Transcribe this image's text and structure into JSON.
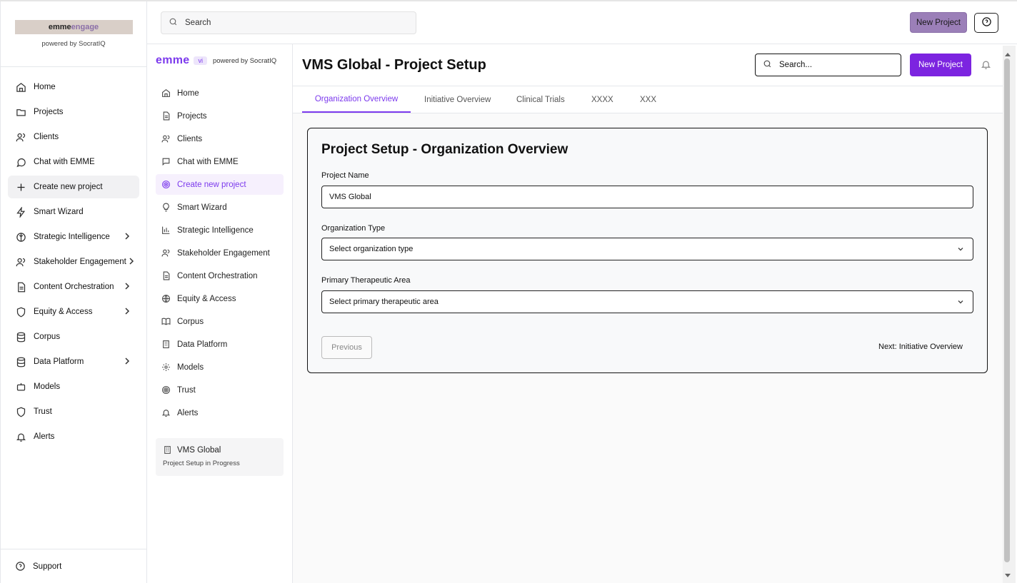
{
  "outer_sidebar": {
    "logo_text_a": "emme",
    "logo_text_b": "engage",
    "powered_by": "powered by SocratIQ",
    "items": [
      {
        "label": "Home",
        "icon": "home-icon"
      },
      {
        "label": "Projects",
        "icon": "folder-icon"
      },
      {
        "label": "Clients",
        "icon": "users-icon"
      },
      {
        "label": "Chat with EMME",
        "icon": "chat-icon"
      },
      {
        "label": "Create new project",
        "icon": "plus-icon",
        "active": true
      },
      {
        "label": "Smart Wizard",
        "icon": "bolt-icon"
      },
      {
        "label": "Strategic Intelligence",
        "icon": "brain-icon",
        "expandable": true
      },
      {
        "label": "Stakeholder Engagement",
        "icon": "users-icon",
        "expandable": true
      },
      {
        "label": "Content Orchestration",
        "icon": "document-icon",
        "expandable": true
      },
      {
        "label": "Equity & Access",
        "icon": "shield-icon",
        "expandable": true
      },
      {
        "label": "Corpus",
        "icon": "database-icon"
      },
      {
        "label": "Data Platform",
        "icon": "database-icon",
        "expandable": true
      },
      {
        "label": "Models",
        "icon": "robot-icon"
      },
      {
        "label": "Trust",
        "icon": "shield-icon"
      },
      {
        "label": "Alerts",
        "icon": "bell-icon"
      }
    ],
    "support_label": "Support"
  },
  "topbar": {
    "search_placeholder": "Search",
    "new_project_label": "New Project"
  },
  "inner_sidebar": {
    "brand": "emme",
    "badge": "vi",
    "powered_by": "powered by SocratIQ",
    "items": [
      {
        "label": "Home",
        "icon": "home-icon"
      },
      {
        "label": "Projects",
        "icon": "document-icon"
      },
      {
        "label": "Clients",
        "icon": "users-icon"
      },
      {
        "label": "Chat with EMME",
        "icon": "chat-icon"
      },
      {
        "label": "Create new project",
        "icon": "target-icon",
        "active": true
      },
      {
        "label": "Smart Wizard",
        "icon": "lightbulb-icon"
      },
      {
        "label": "Strategic Intelligence",
        "icon": "bar-chart-icon"
      },
      {
        "label": "Stakeholder Engagement",
        "icon": "users-icon"
      },
      {
        "label": "Content Orchestration",
        "icon": "document-icon"
      },
      {
        "label": "Equity & Access",
        "icon": "globe-icon"
      },
      {
        "label": "Corpus",
        "icon": "book-icon"
      },
      {
        "label": "Data Platform",
        "icon": "building-icon"
      },
      {
        "label": "Models",
        "icon": "gear-icon"
      },
      {
        "label": "Trust",
        "icon": "target-icon"
      },
      {
        "label": "Alerts",
        "icon": "bell-icon"
      }
    ],
    "project_card": {
      "title": "VMS Global",
      "status": "Project Setup in Progress"
    }
  },
  "main": {
    "title": "VMS Global - Project Setup",
    "search_placeholder": "Search...",
    "new_project_label": "New Project",
    "tabs": [
      {
        "label": "Organization Overview",
        "active": true
      },
      {
        "label": "Initiative Overview"
      },
      {
        "label": "Clinical Trials"
      },
      {
        "label": "XXXX"
      },
      {
        "label": "XXX"
      }
    ],
    "form": {
      "title": "Project Setup - Organization Overview",
      "project_name_label": "Project Name",
      "project_name_value": "VMS Global",
      "org_type_label": "Organization Type",
      "org_type_placeholder": "Select organization type",
      "therapeutic_label": "Primary Therapeutic Area",
      "therapeutic_placeholder": "Select primary therapeutic area",
      "previous_label": "Previous",
      "next_label": "Next: Initiative Overview"
    }
  },
  "colors": {
    "accent": "#7c3aed",
    "primary_button": "#7c24e0",
    "top_button": "#9b7fb8"
  }
}
